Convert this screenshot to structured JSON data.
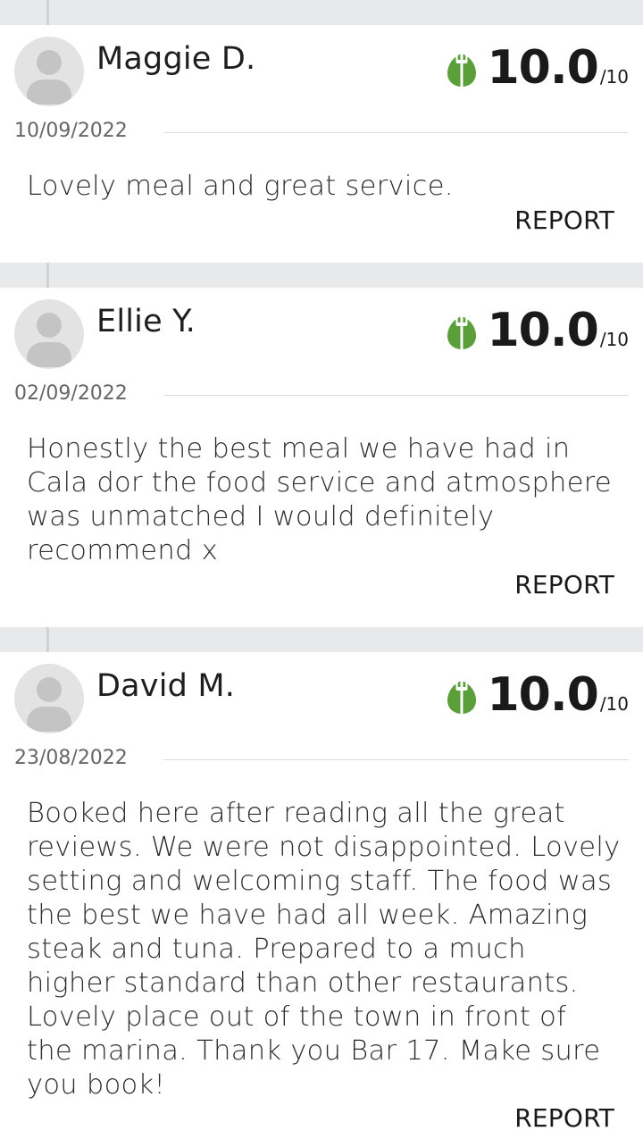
{
  "reviews": [
    {
      "name": "Maggie D.",
      "score": "10.0",
      "out_of": "/10",
      "date": "10/09/2022",
      "text": "Lovely meal and great service.",
      "report_label": "REPORT"
    },
    {
      "name": "Ellie Y.",
      "score": "10.0",
      "out_of": "/10",
      "date": "02/09/2022",
      "text": "Honestly the best meal we have had in Cala dor the food service and atmosphere was unmatched I would definitely recommend x",
      "report_label": "REPORT"
    },
    {
      "name": "David M.",
      "score": "10.0",
      "out_of": "/10",
      "date": "23/08/2022",
      "text": "Booked here after reading all the great reviews. We were not disappointed. Lovely setting and welcoming staff. The food was the best we have had all week. Amazing steak and tuna. Prepared to a much higher standard than other restaurants. Lovely place out of the town in front of the marina. Thank you Bar 17. Make sure you book!",
      "report_label": "REPORT"
    }
  ],
  "colors": {
    "accent_green": "#5a9f3a",
    "card_bg": "#ffffff",
    "page_bg": "#e8e9eb"
  },
  "icons": {
    "rating": "fork-leaf-icon",
    "avatar": "user-placeholder-icon"
  }
}
